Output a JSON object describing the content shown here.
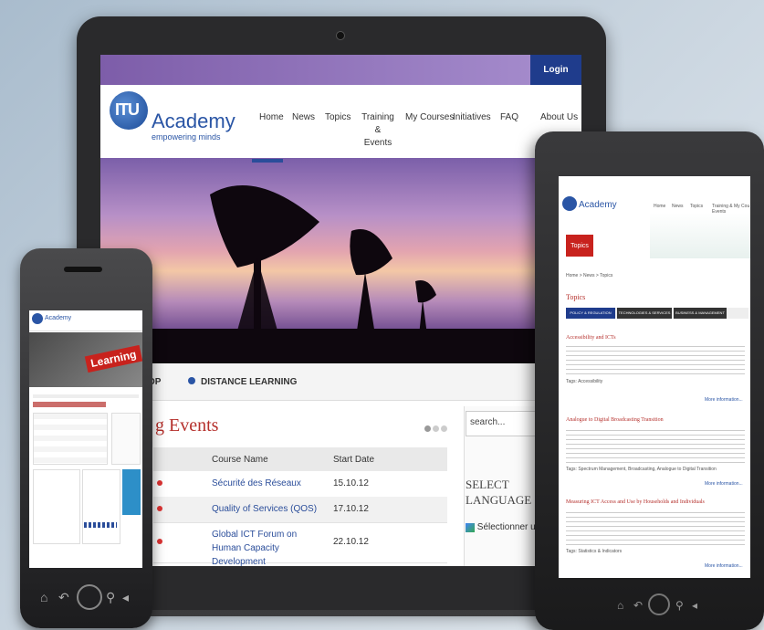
{
  "laptop": {
    "login": "Login",
    "logo": {
      "itu": "ITU",
      "academy": "Academy",
      "tagline": "empowering minds"
    },
    "nav": [
      "Home",
      "News",
      "Topics",
      "Training &\nEvents",
      "My Courses",
      "Initiatives",
      "FAQ",
      "About Us"
    ],
    "tabs": {
      "partial": "OP",
      "distance": "DISTANCE LEARNING"
    },
    "events": {
      "title": "g Events",
      "columns": [
        "Course Name",
        "Start Date"
      ],
      "rows": [
        {
          "name": "Sécurité des Réseaux",
          "date": "15.10.12"
        },
        {
          "name": "Quality of Services (QOS)",
          "date": "17.10.12"
        },
        {
          "name": "Global ICT Forum on Human Capacity Development",
          "date": "22.10.12"
        }
      ]
    },
    "search_placeholder": "search...",
    "select_language": "SELECT LANGUAGE",
    "translate": "Sélectionner une"
  },
  "phone": {
    "logo": "Academy",
    "banner_word": "Learning"
  },
  "tablet": {
    "logo": "Academy",
    "nav": [
      "Home",
      "News",
      "Topics",
      "Training &\nEvents",
      "My Cou"
    ],
    "topics_badge": "Topics",
    "breadcrumb": "Home > News > Topics",
    "section_title": "Topics",
    "tabs": [
      "POLICY & REGULATION",
      "TECHNOLOGIES & SERVICES",
      "BUSINESS & MANAGEMENT"
    ],
    "articles": [
      {
        "title": "Accessibility and ICTs",
        "tags": "Tags: Accessibility",
        "more": "More information..."
      },
      {
        "title": "Analogue to Digital Broadcasting Transition",
        "tags": "Tags: Spectrum Management, Broadcasting, Analogue to Digital Transition",
        "more": "More information..."
      },
      {
        "title": "Measuring ICT Access and Use by Households and Individuals",
        "tags": "Tags: Statistics & Indicators",
        "more": "More information..."
      }
    ]
  },
  "colors": {
    "brand_blue": "#2a55a5",
    "accent_red": "#b5302c",
    "login_bg": "#1f3c8c"
  }
}
